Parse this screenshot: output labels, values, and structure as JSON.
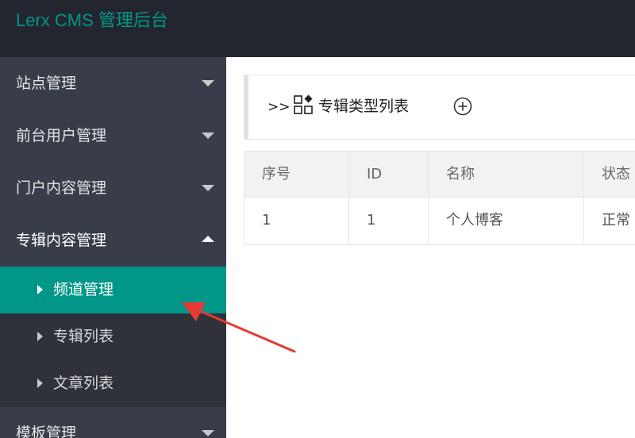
{
  "app": {
    "title": "Lerx CMS 管理后台"
  },
  "sidebar": {
    "menus": [
      {
        "label": "站点管理"
      },
      {
        "label": "前台用户管理"
      },
      {
        "label": "门户内容管理"
      },
      {
        "label": "专辑内容管理",
        "expanded": true
      },
      {
        "label": "模板管理"
      }
    ],
    "submenu": [
      {
        "label": "频道管理",
        "active": true
      },
      {
        "label": "专辑列表"
      },
      {
        "label": "文章列表"
      }
    ]
  },
  "main": {
    "breadcrumb": ">>",
    "title": "专辑类型列表",
    "icons": {
      "list": "grid-list-icon",
      "add": "plus-circle-icon"
    },
    "table": {
      "headers": [
        "序号",
        "ID",
        "名称",
        "状态"
      ],
      "rows": [
        [
          "1",
          "1",
          "个人博客",
          "正常"
        ]
      ]
    }
  },
  "colors": {
    "header_bg": "#23262e",
    "brand": "#009688",
    "sidebar_bg": "#393d49",
    "submenu_bg": "#2f323b",
    "active_bg": "#009688",
    "annotation_arrow": "#e53935"
  }
}
